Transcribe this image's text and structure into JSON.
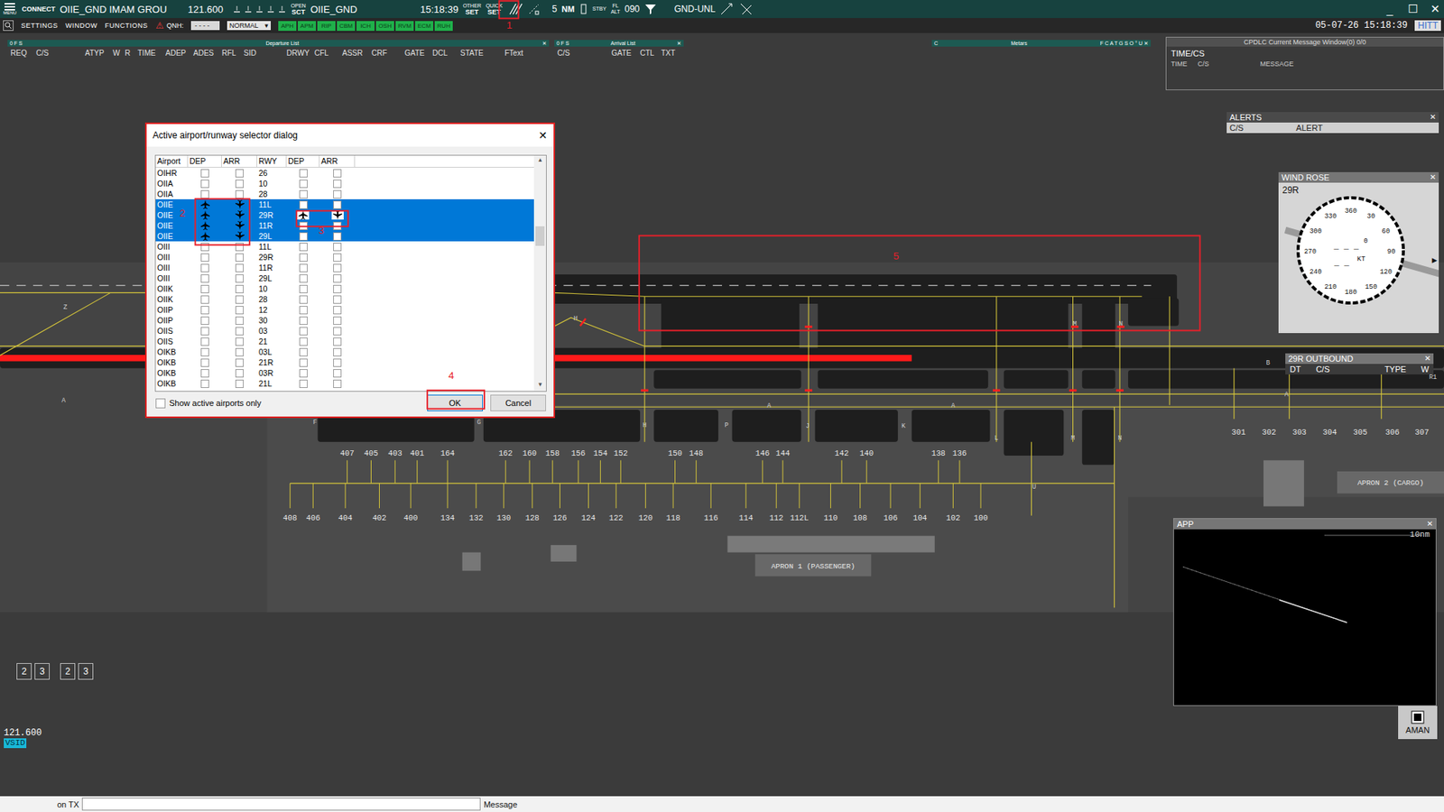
{
  "toolbar": {
    "menu_label": "MENU",
    "connect": "CONNECT",
    "callsign": "OIIE_GND IMAM GROU",
    "frequency": "121.600",
    "open_sct": [
      "OPEN",
      "SCT"
    ],
    "station": "OIIE_GND",
    "clock": "15:18:39",
    "other_set": [
      "OTHER",
      "SET"
    ],
    "quick_set": [
      "QUICK",
      "SET"
    ],
    "range": "5",
    "range_unit": "NM",
    "stby": "STBY",
    "fl_alt": [
      "FL",
      "ALT"
    ],
    "altitude": "090",
    "level_filter": "GND-UNL",
    "window_controls": [
      "_",
      "☐",
      "✕"
    ]
  },
  "menubar": {
    "items": [
      "SETTINGS",
      "WINDOW",
      "FUNCTIONS"
    ],
    "alert_icon": "⚠",
    "qnh_label": "QNH:",
    "qnh_value": "- - - -",
    "mode": "NORMAL",
    "airports": [
      "APH",
      "APM",
      "RIP",
      "CBM",
      "ICH",
      "OSH",
      "RVM",
      "ECM",
      "RUH"
    ],
    "datetime": "05-07-26 15:18:39",
    "user": "HITT"
  },
  "departure_list": {
    "title": "Departure List",
    "flags": "0 F S",
    "close": "✕",
    "columns": [
      "REQ",
      "C/S",
      "ATYP",
      "W",
      "R",
      "TIME",
      "ADEP",
      "ADES",
      "RFL",
      "SID",
      "DRWY",
      "CFL",
      "ASSR",
      "CRF",
      "GATE",
      "DCL",
      "STATE",
      "FText"
    ]
  },
  "arrival_list": {
    "title": "Arrival List",
    "flags": "0 F S",
    "close": "✕",
    "columns": [
      "C/S",
      "GATE",
      "CTL",
      "TXT"
    ]
  },
  "metars": {
    "title": "Metars",
    "flag": "C",
    "letters": "F C A T G S O ° U",
    "close": "✕"
  },
  "cpdlc": {
    "title": "CPDLC Current Message Window(0) 0/0",
    "subtitle": "TIME/CS",
    "columns": [
      "TIME",
      "C/S",
      "MESSAGE"
    ]
  },
  "alerts": {
    "title": "ALERTS",
    "close": "✕",
    "columns": [
      "C/S",
      "ALERT"
    ]
  },
  "wind_rose": {
    "title": "WIND ROSE",
    "close": "✕",
    "runway": "29R",
    "headings": [
      "360",
      "30",
      "60",
      "90",
      "120",
      "150",
      "180",
      "210",
      "240",
      "270",
      "300",
      "330"
    ],
    "direction": "_ _ _",
    "marker": "0",
    "speed": "_ _",
    "unit": "KT",
    "arrow": "▶"
  },
  "outbound": {
    "title": "29R OUTBOUND",
    "close": "✕",
    "columns": [
      "DT",
      "C/S",
      "TYPE",
      "W"
    ]
  },
  "app": {
    "title": "APP",
    "close": "✕",
    "scale": "10nm"
  },
  "aman": {
    "label": "AMAN"
  },
  "sector_boxes": [
    "2",
    "3",
    "2",
    "3"
  ],
  "status": {
    "frequency": "121.600",
    "tag": "VSID"
  },
  "message_bar": {
    "tx_label": "on TX",
    "value": "",
    "message_label": "Message"
  },
  "dialog": {
    "title": "Active airport/runway selector dialog",
    "close": "✕",
    "columns": [
      "Airport",
      "DEP",
      "ARR",
      "RWY",
      "DEP",
      "ARR"
    ],
    "rows": [
      {
        "airport": "OIHR",
        "dep": false,
        "arr": false,
        "rwy": "26",
        "rwy_dep": false,
        "rwy_arr": false,
        "selected": false
      },
      {
        "airport": "OIIA",
        "dep": false,
        "arr": false,
        "rwy": "10",
        "rwy_dep": false,
        "rwy_arr": false,
        "selected": false
      },
      {
        "airport": "OIIA",
        "dep": false,
        "arr": false,
        "rwy": "28",
        "rwy_dep": false,
        "rwy_arr": false,
        "selected": false
      },
      {
        "airport": "OIIE",
        "dep": true,
        "arr": true,
        "rwy": "11L",
        "rwy_dep": false,
        "rwy_arr": false,
        "selected": true
      },
      {
        "airport": "OIIE",
        "dep": true,
        "arr": true,
        "rwy": "29R",
        "rwy_dep": true,
        "rwy_arr": true,
        "selected": true
      },
      {
        "airport": "OIIE",
        "dep": true,
        "arr": true,
        "rwy": "11R",
        "rwy_dep": false,
        "rwy_arr": false,
        "selected": true
      },
      {
        "airport": "OIIE",
        "dep": true,
        "arr": true,
        "rwy": "29L",
        "rwy_dep": false,
        "rwy_arr": false,
        "selected": true
      },
      {
        "airport": "OIII",
        "dep": false,
        "arr": false,
        "rwy": "11L",
        "rwy_dep": false,
        "rwy_arr": false,
        "selected": false
      },
      {
        "airport": "OIII",
        "dep": false,
        "arr": false,
        "rwy": "29R",
        "rwy_dep": false,
        "rwy_arr": false,
        "selected": false
      },
      {
        "airport": "OIII",
        "dep": false,
        "arr": false,
        "rwy": "11R",
        "rwy_dep": false,
        "rwy_arr": false,
        "selected": false
      },
      {
        "airport": "OIII",
        "dep": false,
        "arr": false,
        "rwy": "29L",
        "rwy_dep": false,
        "rwy_arr": false,
        "selected": false
      },
      {
        "airport": "OIIK",
        "dep": false,
        "arr": false,
        "rwy": "10",
        "rwy_dep": false,
        "rwy_arr": false,
        "selected": false
      },
      {
        "airport": "OIIK",
        "dep": false,
        "arr": false,
        "rwy": "28",
        "rwy_dep": false,
        "rwy_arr": false,
        "selected": false
      },
      {
        "airport": "OIIP",
        "dep": false,
        "arr": false,
        "rwy": "12",
        "rwy_dep": false,
        "rwy_arr": false,
        "selected": false
      },
      {
        "airport": "OIIP",
        "dep": false,
        "arr": false,
        "rwy": "30",
        "rwy_dep": false,
        "rwy_arr": false,
        "selected": false
      },
      {
        "airport": "OIIS",
        "dep": false,
        "arr": false,
        "rwy": "03",
        "rwy_dep": false,
        "rwy_arr": false,
        "selected": false
      },
      {
        "airport": "OIIS",
        "dep": false,
        "arr": false,
        "rwy": "21",
        "rwy_dep": false,
        "rwy_arr": false,
        "selected": false
      },
      {
        "airport": "OIKB",
        "dep": false,
        "arr": false,
        "rwy": "03L",
        "rwy_dep": false,
        "rwy_arr": false,
        "selected": false
      },
      {
        "airport": "OIKB",
        "dep": false,
        "arr": false,
        "rwy": "21R",
        "rwy_dep": false,
        "rwy_arr": false,
        "selected": false
      },
      {
        "airport": "OIKB",
        "dep": false,
        "arr": false,
        "rwy": "03R",
        "rwy_dep": false,
        "rwy_arr": false,
        "selected": false
      },
      {
        "airport": "OIKB",
        "dep": false,
        "arr": false,
        "rwy": "21L",
        "rwy_dep": false,
        "rwy_arr": false,
        "selected": false
      }
    ],
    "show_active": {
      "label": "Show active airports only",
      "checked": false
    },
    "buttons": [
      "OK",
      "Cancel"
    ]
  },
  "map": {
    "taxiways": [
      "Z",
      "H",
      "A",
      "A",
      "A",
      "A",
      "B",
      "R1",
      "M",
      "N",
      "F",
      "G",
      "H",
      "P",
      "J",
      "K",
      "L",
      "M",
      "N",
      "U"
    ],
    "stands_north": [
      "407",
      "405",
      "403",
      "401",
      "164",
      "162",
      "160",
      "158",
      "156",
      "154",
      "152",
      "150",
      "148",
      "146",
      "144",
      "142",
      "140",
      "138",
      "136"
    ],
    "stands_south": [
      "408",
      "406",
      "404",
      "402",
      "400",
      "134",
      "132",
      "130",
      "128",
      "126",
      "124",
      "122",
      "120",
      "118",
      "116",
      "114",
      "112",
      "112L",
      "110",
      "108",
      "106",
      "104",
      "102",
      "100"
    ],
    "stands_east": [
      "301",
      "302",
      "303",
      "304",
      "305",
      "306",
      "307"
    ],
    "aprons": [
      "APRON 1 (PASSENGER)",
      "APRON 2 (CARGO)"
    ]
  },
  "annotations": [
    "1",
    "2",
    "3",
    "4",
    "5"
  ]
}
